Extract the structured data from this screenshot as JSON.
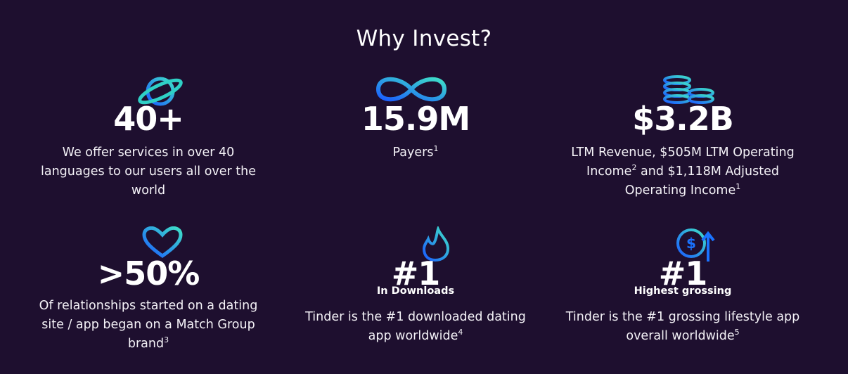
{
  "section": {
    "title": "Why Invest?"
  },
  "colors": {
    "background": "#1e0f2f",
    "icon_blue": "#1a73ff",
    "icon_teal": "#3fd6c8"
  },
  "cards": [
    {
      "icon": "planet-icon",
      "stat": "40+",
      "sub": "",
      "desc_parts": [
        "We offer services in over 40 languages to our users all over the world"
      ]
    },
    {
      "icon": "infinity-icon",
      "stat": "15.9M",
      "sub": "",
      "desc_parts": [
        "Payers",
        "1"
      ]
    },
    {
      "icon": "coins-icon",
      "stat": "$3.2B",
      "sub": "",
      "desc_parts": [
        "LTM Revenue, $505M LTM Operating Income",
        "2",
        " and $1,118M Adjusted Operating Income",
        "1"
      ]
    },
    {
      "icon": "heart-icon",
      "stat": ">50%",
      "sub": "",
      "desc_parts": [
        "Of relationships started on a dating site / app began on a Match Group brand",
        "3"
      ]
    },
    {
      "icon": "flame-icon",
      "stat": "#1",
      "sub": "In Downloads",
      "desc_parts": [
        "Tinder is the #1 downloaded dating app worldwide",
        "4"
      ]
    },
    {
      "icon": "dollar-growth-icon",
      "stat": "#1",
      "sub": "Highest grossing",
      "desc_parts": [
        "Tinder is the #1 grossing lifestyle app overall worldwide",
        "5"
      ]
    }
  ]
}
